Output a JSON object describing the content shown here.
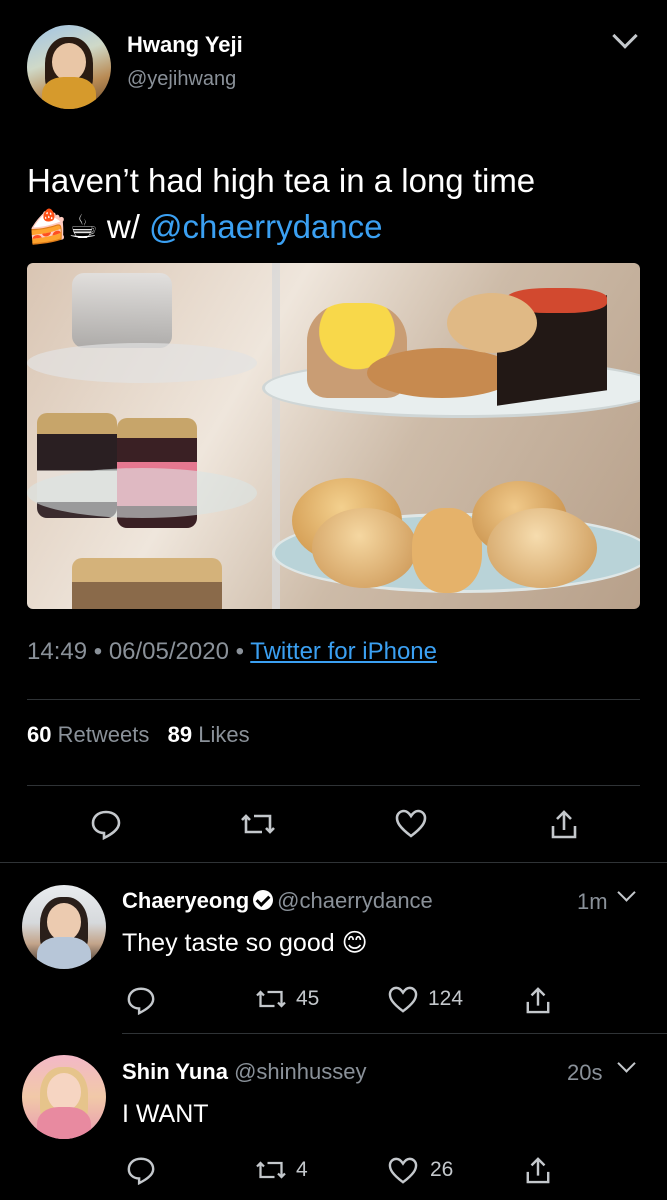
{
  "main_tweet": {
    "author_name": "Hwang Yeji",
    "author_handle": "@yejihwang",
    "text_line1": "Haven’t had high tea in a long time",
    "emoji": "🍰☕",
    "text_prefix": " w/ ",
    "mention": "@chaerrydance",
    "time": "14:49",
    "date": "06/05/2020",
    "source": "Twitter for iPhone",
    "retweets_count": "60",
    "retweets_label": "Retweets",
    "likes_count": "89",
    "likes_label": "Likes"
  },
  "replies": [
    {
      "name": "Chaeryeong",
      "handle": "@chaerrydance",
      "time": "1m",
      "text": "They taste so good",
      "emoji": "😊",
      "retweets": "45",
      "likes": "124"
    },
    {
      "name": "Shin Yuna",
      "handle": "@shinhussey",
      "time": "20s",
      "text": "I WANT",
      "retweets": "4",
      "likes": "26"
    }
  ],
  "icons": {
    "reply": "reply-icon",
    "retweet": "retweet-icon",
    "like": "heart-icon",
    "share": "share-icon",
    "more": "chevron-down-icon"
  },
  "colors": {
    "background": "#000000",
    "link": "#3ba0f2",
    "muted": "#8a9199",
    "icon": "#c4c8cc"
  }
}
